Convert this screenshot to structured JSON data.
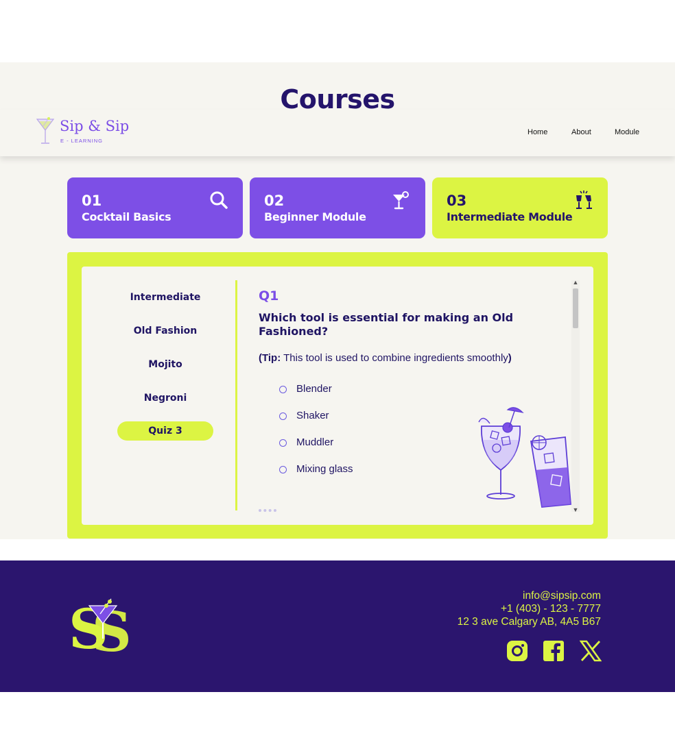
{
  "page": {
    "title": "Courses"
  },
  "brand": {
    "name": "Sip & Sip",
    "tagline": "E - LEARNING"
  },
  "nav": {
    "items": [
      "Home",
      "About",
      "Module"
    ]
  },
  "modules": [
    {
      "number": "01",
      "title": "Cocktail Basics",
      "icon": "search-icon",
      "color": "#7d4fe6"
    },
    {
      "number": "02",
      "title": "Beginner Module",
      "icon": "cocktail-glass-icon",
      "color": "#7d4fe6"
    },
    {
      "number": "03",
      "title": "Intermediate Module",
      "icon": "cheers-glasses-icon",
      "color": "#dcf443"
    }
  ],
  "sidebar": {
    "items": [
      "Intermediate",
      "Old Fashion",
      "Mojito",
      "Negroni",
      "Quiz 3"
    ],
    "active": "Quiz 3"
  },
  "quiz": {
    "label": "Q1",
    "question": "Which tool is essential for making an Old Fashioned?",
    "tip_open": "(",
    "tip_label": "Tip:",
    "tip_text": " This tool is used to combine ingredients smoothly",
    "tip_close": ")",
    "options": [
      "Blender",
      "Shaker",
      "Muddler",
      "Mixing glass"
    ]
  },
  "footer": {
    "email": "info@sipsip.com",
    "phone": "+1 (403) - 123 - 7777",
    "address": "12 3 ave Calgary AB, 4A5 B67",
    "social": [
      "instagram-icon",
      "facebook-icon",
      "x-icon"
    ]
  },
  "colors": {
    "accent_purple": "#7d4fe6",
    "accent_lime": "#dcf443",
    "navy": "#2b156e",
    "background": "#f6f5f0"
  }
}
